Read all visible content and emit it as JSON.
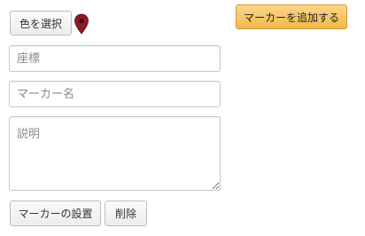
{
  "toolbar": {
    "select_color_label": "色を選択",
    "add_marker_label": "マーカーを追加する"
  },
  "form": {
    "coordinates_placeholder": "座標",
    "coordinates_value": "",
    "marker_name_placeholder": "マーカー名",
    "marker_name_value": "",
    "description_placeholder": "説明",
    "description_value": ""
  },
  "actions": {
    "place_marker_label": "マーカーの設置",
    "delete_label": "削除"
  },
  "icons": {
    "marker_pin": "map-pin-icon"
  },
  "colors": {
    "pin": "#8a1a28",
    "add_button": "#f3b848"
  }
}
